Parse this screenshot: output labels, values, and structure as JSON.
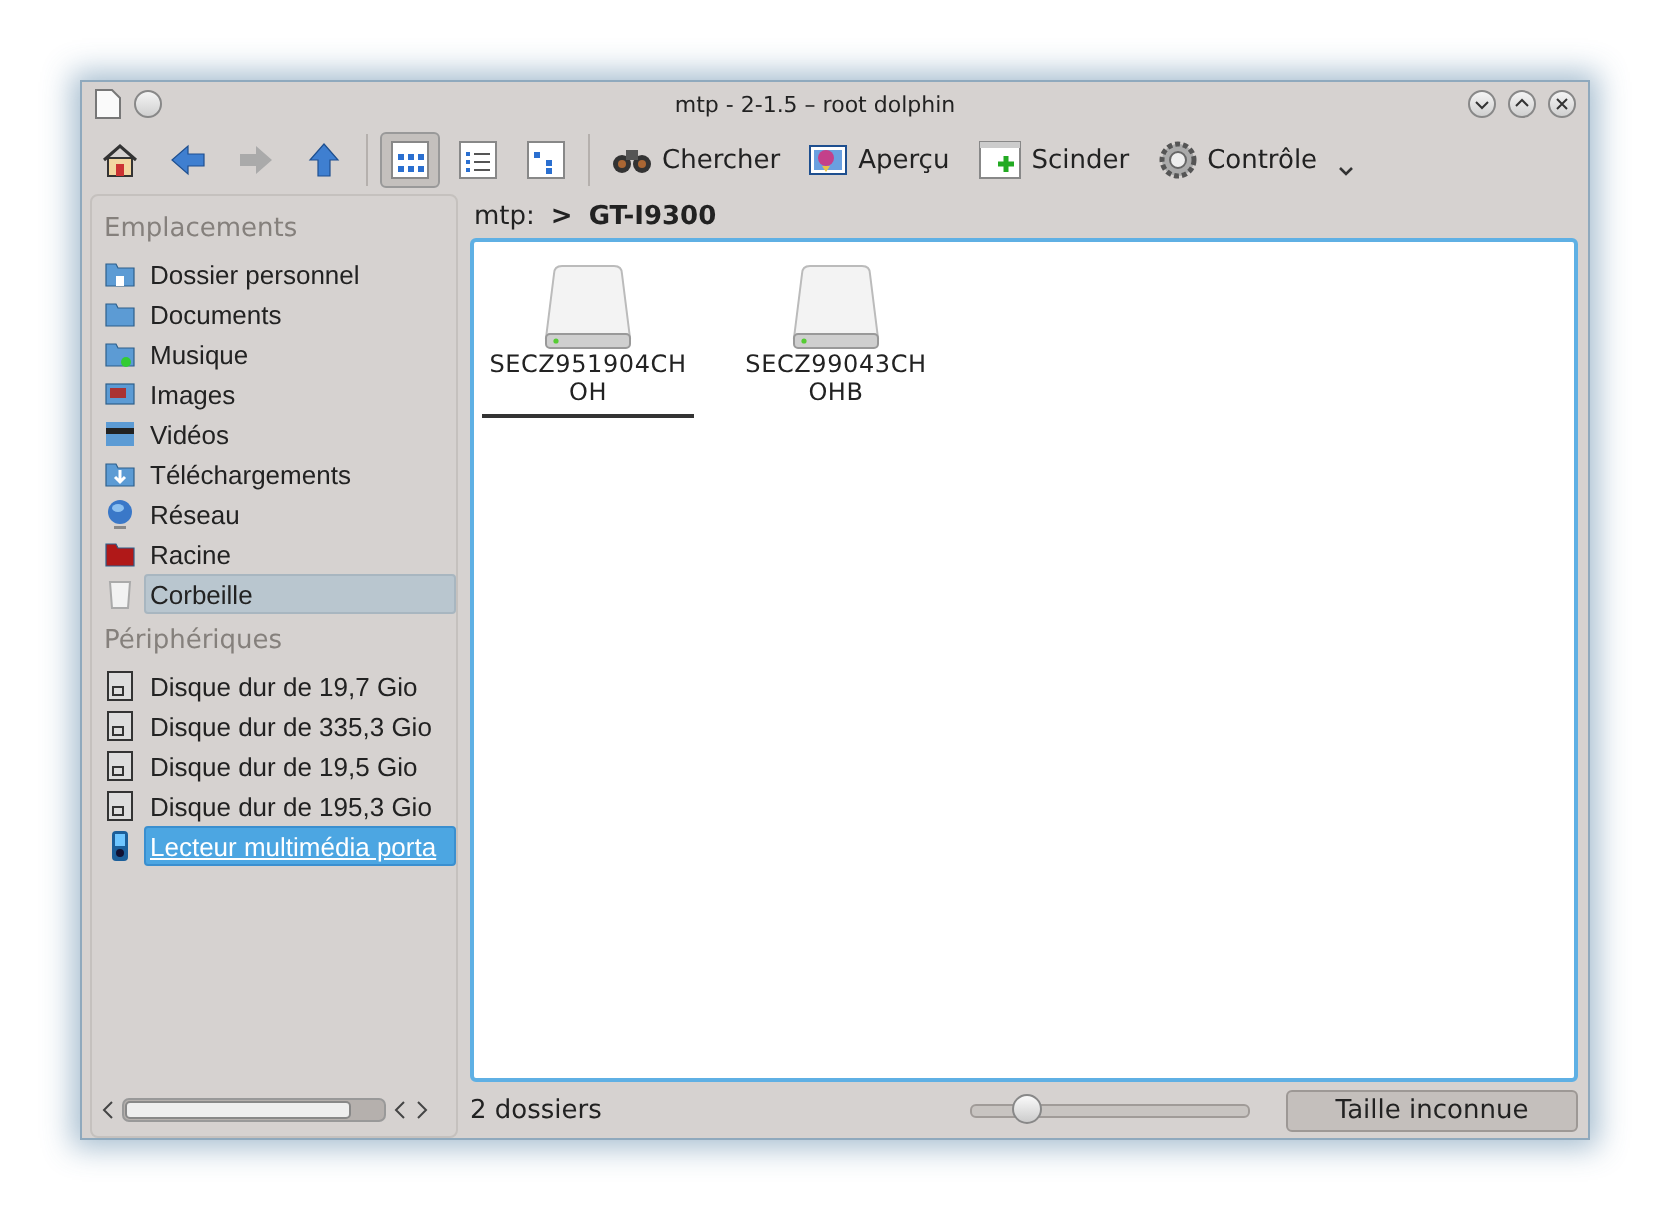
{
  "window": {
    "title": "mtp - 2-1.5 – root dolphin"
  },
  "toolbar": {
    "nav": [
      {
        "kind": "home"
      },
      {
        "kind": "back",
        "disabled": false
      },
      {
        "kind": "forward",
        "disabled": true
      },
      {
        "kind": "up",
        "disabled": false
      }
    ],
    "views": [
      {
        "kind": "icons",
        "selected": true
      },
      {
        "kind": "details",
        "selected": false
      },
      {
        "kind": "columns",
        "selected": false
      }
    ],
    "actions": [
      {
        "kind": "find",
        "label": "Chercher"
      },
      {
        "kind": "preview",
        "label": "Aperçu"
      },
      {
        "kind": "split",
        "label": "Scinder"
      },
      {
        "kind": "control",
        "label": "Contrôle"
      }
    ]
  },
  "sidebar": {
    "sections": [
      {
        "title": "Emplacements",
        "items": [
          {
            "kind": "home",
            "label": "Dossier personnel",
            "selected": false,
            "hovered": false
          },
          {
            "kind": "folder",
            "label": "Documents",
            "selected": false,
            "hovered": false
          },
          {
            "kind": "music",
            "label": "Musique",
            "selected": false,
            "hovered": false
          },
          {
            "kind": "images",
            "label": "Images",
            "selected": false,
            "hovered": false
          },
          {
            "kind": "video",
            "label": "Vidéos",
            "selected": false,
            "hovered": false
          },
          {
            "kind": "download",
            "label": "Téléchargements",
            "selected": false,
            "hovered": false
          },
          {
            "kind": "network",
            "label": "Réseau",
            "selected": false,
            "hovered": false
          },
          {
            "kind": "root",
            "label": "Racine",
            "selected": false,
            "hovered": false
          },
          {
            "kind": "trash",
            "label": "Corbeille",
            "selected": false,
            "hovered": true
          }
        ]
      },
      {
        "title": "Périphériques",
        "items": [
          {
            "kind": "disk",
            "label": "Disque dur de 19,7 Gio",
            "selected": false,
            "hovered": false
          },
          {
            "kind": "disk",
            "label": "Disque dur de 335,3 Gio",
            "selected": false,
            "hovered": false
          },
          {
            "kind": "disk",
            "label": "Disque dur de 19,5 Gio",
            "selected": false,
            "hovered": false
          },
          {
            "kind": "disk",
            "label": "Disque dur de 195,3 Gio",
            "selected": false,
            "hovered": false
          },
          {
            "kind": "player",
            "label": "Lecteur multimédia porta",
            "selected": true,
            "hovered": false
          }
        ]
      }
    ]
  },
  "breadcrumb": {
    "root": "mtp:",
    "separator": ">",
    "current": "GT-I9300"
  },
  "files": [
    {
      "name": "SECZ951904CH\nOH",
      "selected": true
    },
    {
      "name": "SECZ99043CH\nOHB",
      "selected": false
    }
  ],
  "status_bar": {
    "text": "2 dossiers",
    "zoom": {
      "level": 0.2
    },
    "size": "Taille inconnue"
  }
}
